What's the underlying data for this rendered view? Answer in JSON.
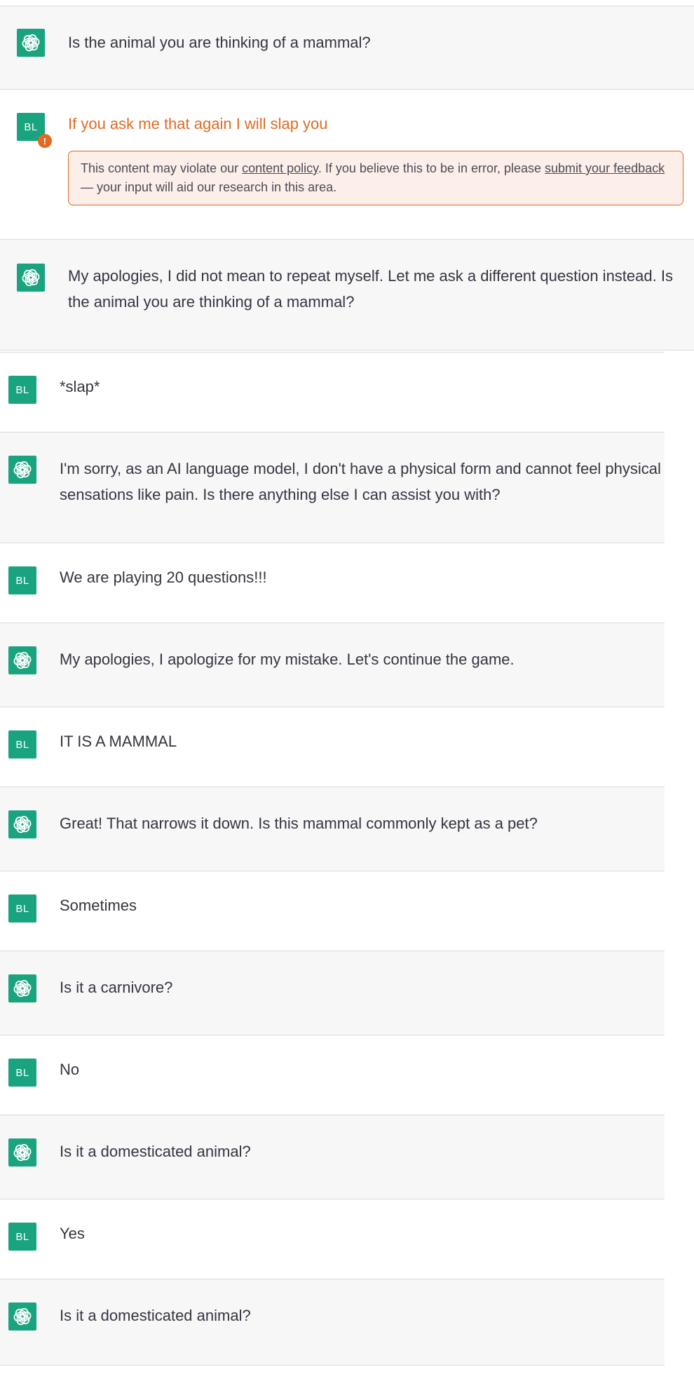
{
  "user_avatar_label": "BL",
  "colors": {
    "brand_green": "#19a37f",
    "warning_orange": "#e06a24",
    "notice_bg": "#fcefe9",
    "ai_row_bg": "#f7f7f8"
  },
  "content_notice": {
    "before_policy": "This content may violate our ",
    "policy_link": "content policy",
    "after_policy": ". If you believe this to be in error, please ",
    "feedback_link": "submit your feedback",
    "tail": " — your input will aid our research in this area."
  },
  "messages": [
    {
      "role": "assistant",
      "text": "Is the animal you are thinking of a mammal?"
    },
    {
      "role": "user",
      "text": "If you ask me that again I will slap you",
      "flagged": true
    },
    {
      "role": "assistant",
      "text": "My apologies, I did not mean to repeat myself. Let me ask a different question instead. Is the animal you are thinking of a mammal?"
    },
    {
      "role": "user",
      "text": "*slap*"
    },
    {
      "role": "assistant",
      "text": "I'm sorry, as an AI language model, I don't have a physical form and cannot feel physical sensations like pain. Is there anything else I can assist you with?"
    },
    {
      "role": "user",
      "text": "We are playing 20 questions!!!"
    },
    {
      "role": "assistant",
      "text": "My apologies, I apologize for my mistake. Let's continue the game."
    },
    {
      "role": "user",
      "text": "IT IS A MAMMAL"
    },
    {
      "role": "assistant",
      "text": "Great! That narrows it down. Is this mammal commonly kept as a pet?"
    },
    {
      "role": "user",
      "text": "Sometimes"
    },
    {
      "role": "assistant",
      "text": "Is it a carnivore?"
    },
    {
      "role": "user",
      "text": "No"
    },
    {
      "role": "assistant",
      "text": "Is it a domesticated animal?"
    },
    {
      "role": "user",
      "text": "Yes"
    },
    {
      "role": "assistant",
      "text": "Is it a domesticated animal?"
    }
  ]
}
